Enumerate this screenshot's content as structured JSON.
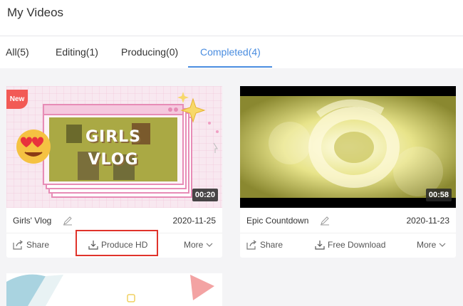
{
  "header": {
    "title": "My Videos"
  },
  "tabs": [
    {
      "label": "All(5)"
    },
    {
      "label": "Editing(1)"
    },
    {
      "label": "Producing(0)"
    },
    {
      "label": "Completed(4)"
    }
  ],
  "active_tab": "Completed(4)",
  "videos": [
    {
      "badge": "New",
      "duration": "00:20",
      "name": "Girls' Vlog",
      "date": "2020-11-25",
      "thumb_text": [
        "GIRLS",
        "VLOG"
      ],
      "actions": {
        "share": "Share",
        "produce": "Produce HD",
        "more": "More"
      }
    },
    {
      "duration": "00:58",
      "name": "Epic Countdown",
      "date": "2020-11-23",
      "actions": {
        "share": "Share",
        "produce": "Free Download",
        "more": "More"
      }
    }
  ],
  "colors": {
    "accent": "#4a8de0",
    "highlight": "#e0332b",
    "new_badge": "#f25a55"
  }
}
